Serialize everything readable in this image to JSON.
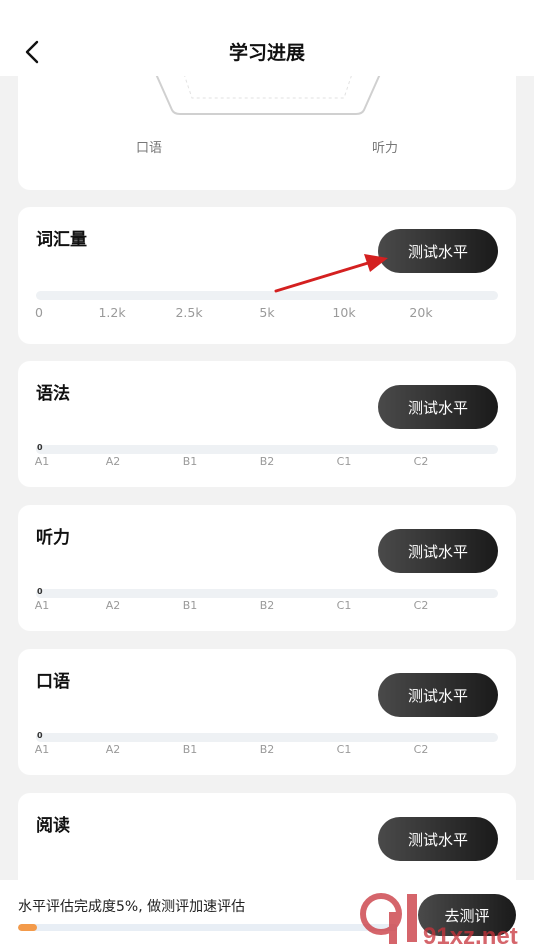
{
  "header": {
    "title": "学习进展"
  },
  "radar": {
    "labels": [
      "口语",
      "听力"
    ]
  },
  "skills": [
    {
      "title": "词汇量",
      "button": "测试水平",
      "ticks": [
        "0",
        "1.2k",
        "2.5k",
        "5k",
        "10k",
        "20k"
      ]
    },
    {
      "title": "语法",
      "button": "测试水平",
      "zero": "0",
      "ticks": [
        "A1",
        "A2",
        "B1",
        "B2",
        "C1",
        "C2"
      ]
    },
    {
      "title": "听力",
      "button": "测试水平",
      "zero": "0",
      "ticks": [
        "A1",
        "A2",
        "B1",
        "B2",
        "C1",
        "C2"
      ]
    },
    {
      "title": "口语",
      "button": "测试水平",
      "zero": "0",
      "ticks": [
        "A1",
        "A2",
        "B1",
        "B2",
        "C1",
        "C2"
      ]
    },
    {
      "title": "阅读",
      "button": "测试水平"
    }
  ],
  "bottom": {
    "progress_text": "水平评估完成度5%, 做测评加速评估",
    "progress_fraction": 0.05,
    "button": "去测评"
  },
  "watermark": {
    "text": "91xz.net"
  },
  "colors": {
    "accent_progress": "#f39a4a",
    "button_dark": "#1a1a1a",
    "annotation_arrow": "#d42020",
    "watermark": "#c8323a"
  }
}
